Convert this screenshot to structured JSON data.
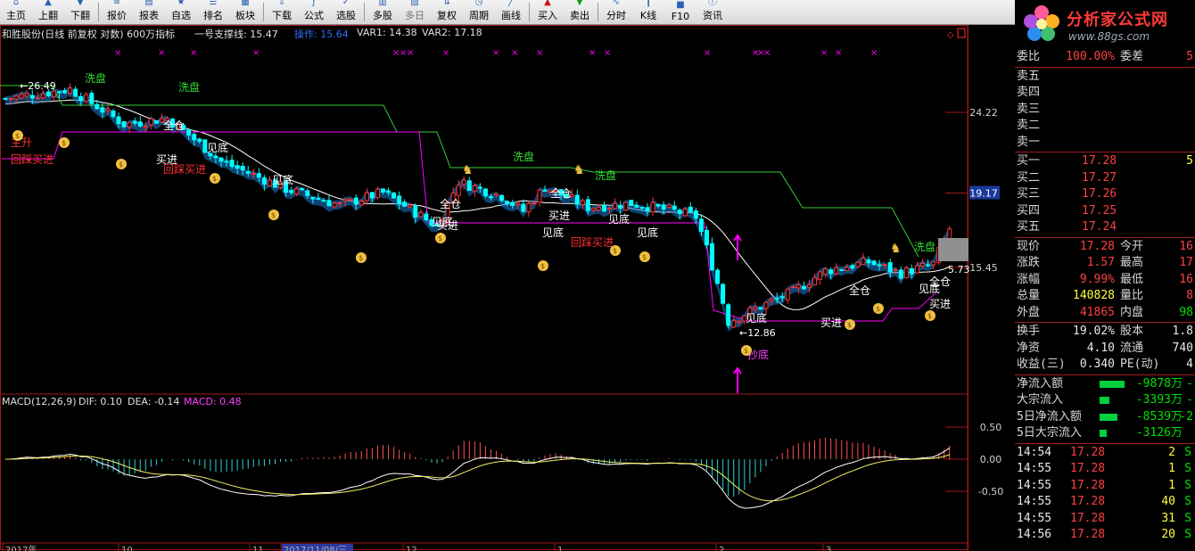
{
  "toolbar": {
    "buttons": [
      {
        "label": "主页",
        "icon": "home-icon"
      },
      {
        "label": "上翻",
        "icon": "page-up-icon"
      },
      {
        "label": "下翻",
        "icon": "page-down-icon"
      },
      {
        "label": "报价",
        "icon": "quote-icon"
      },
      {
        "label": "报表",
        "icon": "report-icon"
      },
      {
        "label": "自选",
        "icon": "favorites-icon"
      },
      {
        "label": "排名",
        "icon": "ranking-icon"
      },
      {
        "label": "板块",
        "icon": "sector-icon"
      },
      {
        "label": "下载",
        "icon": "download-icon"
      },
      {
        "label": "公式",
        "icon": "formula-icon"
      },
      {
        "label": "选股",
        "icon": "stock-picker-icon"
      },
      {
        "label": "多股",
        "icon": "multi-stock-icon"
      },
      {
        "label": "多日",
        "icon": "multi-day-icon"
      },
      {
        "label": "复权",
        "icon": "adjust-icon"
      },
      {
        "label": "周期",
        "icon": "period-icon"
      },
      {
        "label": "画线",
        "icon": "draw-line-icon"
      },
      {
        "label": "买入",
        "icon": "buy-icon"
      },
      {
        "label": "卖出",
        "icon": "sell-icon"
      },
      {
        "label": "分时",
        "icon": "intraday-icon"
      },
      {
        "label": "K线",
        "icon": "kline-icon"
      },
      {
        "label": "F10",
        "icon": "f10-icon"
      },
      {
        "label": "资讯",
        "icon": "news-icon"
      }
    ]
  },
  "logo": {
    "brand": "分析家公式网",
    "url": "www.88gs.com",
    "icon": "flower-logo-icon"
  },
  "main_header": {
    "title": "和胜股份(日线 前复权 对数) 600万指标",
    "support": "一号支撑线: 15.47",
    "operate": "操作: 15.64",
    "var1": "VAR1: 14.38",
    "var2": "VAR2: 17.18"
  },
  "colors": {
    "up": "#ff3030",
    "down": "#00ffff",
    "magenta": "#ff00ff",
    "green_line": "#33cc33",
    "white_line": "#ffffff",
    "blue_band": "#1a7acc",
    "axis": "#a01818"
  },
  "axis_right": {
    "labels": [
      "24.22",
      "19.17",
      "15.45"
    ],
    "highlight": "19.17"
  },
  "markers": {
    "high": "26.49",
    "low": "12.86",
    "last": "5.73",
    "texts": [
      {
        "t": "洗盘",
        "c": "green"
      },
      {
        "t": "洗盘",
        "c": "green"
      },
      {
        "t": "洗盘",
        "c": "green"
      },
      {
        "t": "洗盘",
        "c": "green"
      },
      {
        "t": "洗盘",
        "c": "green"
      },
      {
        "t": "主升",
        "c": "red"
      },
      {
        "t": "回踩买进",
        "c": "red"
      },
      {
        "t": "回踩买进",
        "c": "red"
      },
      {
        "t": "回踩买进",
        "c": "red"
      },
      {
        "t": "全仓",
        "c": "white"
      },
      {
        "t": "全仓",
        "c": "white"
      },
      {
        "t": "全仓",
        "c": "white"
      },
      {
        "t": "全仓",
        "c": "white"
      },
      {
        "t": "全仓",
        "c": "white"
      },
      {
        "t": "买进",
        "c": "white"
      },
      {
        "t": "买进",
        "c": "white"
      },
      {
        "t": "买进",
        "c": "white"
      },
      {
        "t": "买进",
        "c": "white"
      },
      {
        "t": "买进",
        "c": "white"
      },
      {
        "t": "见底",
        "c": "white"
      },
      {
        "t": "见底",
        "c": "white"
      },
      {
        "t": "见底",
        "c": "white"
      },
      {
        "t": "见底",
        "c": "white"
      },
      {
        "t": "见底",
        "c": "white"
      },
      {
        "t": "见底",
        "c": "white"
      },
      {
        "t": "见底",
        "c": "white"
      },
      {
        "t": "见底",
        "c": "white"
      },
      {
        "t": "抄底",
        "c": "magenta"
      }
    ]
  },
  "macd": {
    "header": "MACD(12,26,9)",
    "dif": "DIF: 0.10",
    "dea": "DEA: -0.14",
    "macd": "MACD: 0.48",
    "axis": [
      "0.50",
      "0.00",
      "-0.50"
    ]
  },
  "date_axis": [
    "2017年",
    "10",
    "11",
    "2017/11/08/三",
    "12",
    "1",
    "2",
    "3"
  ],
  "panel": {
    "weibi": {
      "label": "委比",
      "value": "100.00%",
      "label2": "委差",
      "value2": "5"
    },
    "sells": [
      {
        "label": "卖五",
        "price": "",
        "vol": ""
      },
      {
        "label": "卖四",
        "price": "",
        "vol": ""
      },
      {
        "label": "卖三",
        "price": "",
        "vol": ""
      },
      {
        "label": "卖二",
        "price": "",
        "vol": ""
      },
      {
        "label": "卖一",
        "price": "",
        "vol": ""
      }
    ],
    "buys": [
      {
        "label": "买一",
        "price": "17.28",
        "vol": "5"
      },
      {
        "label": "买二",
        "price": "17.27",
        "vol": ""
      },
      {
        "label": "买三",
        "price": "17.26",
        "vol": ""
      },
      {
        "label": "买四",
        "price": "17.25",
        "vol": ""
      },
      {
        "label": "买五",
        "price": "17.24",
        "vol": ""
      }
    ],
    "stats": [
      {
        "l1": "现价",
        "v1": "17.28",
        "l2": "今开",
        "v2": "16"
      },
      {
        "l1": "涨跌",
        "v1": "1.57",
        "l2": "最高",
        "v2": "17"
      },
      {
        "l1": "涨幅",
        "v1": "9.99%",
        "l2": "最低",
        "v2": "16"
      },
      {
        "l1": "总量",
        "v1": "140828",
        "l2": "量比",
        "v2": "8"
      },
      {
        "l1": "外盘",
        "v1": "41865",
        "l2": "内盘",
        "v2": "98"
      }
    ],
    "stats2": [
      {
        "l1": "换手",
        "v1": "19.02%",
        "l2": "股本",
        "v2": "1.8"
      },
      {
        "l1": "净资",
        "v1": "4.10",
        "l2": "流通",
        "v2": "740"
      },
      {
        "l1": "收益(三)",
        "v1": "0.340",
        "l2": "PE(动)",
        "v2": "4"
      }
    ],
    "flows": [
      {
        "label": "净流入额",
        "value": "-9878万",
        "tail": "-",
        "bar": 0.5
      },
      {
        "label": "大宗流入",
        "value": "-3393万",
        "tail": "-",
        "bar": 0.2
      },
      {
        "label": "5日净流入额",
        "value": "-8539万",
        "tail": "-2",
        "bar": 0.35
      },
      {
        "label": "5日大宗流入",
        "value": "-3126万",
        "tail": "",
        "bar": 0.15
      }
    ],
    "ticks": [
      {
        "time": "14:54",
        "price": "17.28",
        "vol": "2",
        "side": "S"
      },
      {
        "time": "14:55",
        "price": "17.28",
        "vol": "1",
        "side": "S"
      },
      {
        "time": "14:55",
        "price": "17.28",
        "vol": "1",
        "side": "S"
      },
      {
        "time": "14:55",
        "price": "17.28",
        "vol": "40",
        "side": "S"
      },
      {
        "time": "14:55",
        "price": "17.28",
        "vol": "31",
        "side": "S"
      },
      {
        "time": "14:56",
        "price": "17.28",
        "vol": "20",
        "side": "S"
      }
    ]
  }
}
